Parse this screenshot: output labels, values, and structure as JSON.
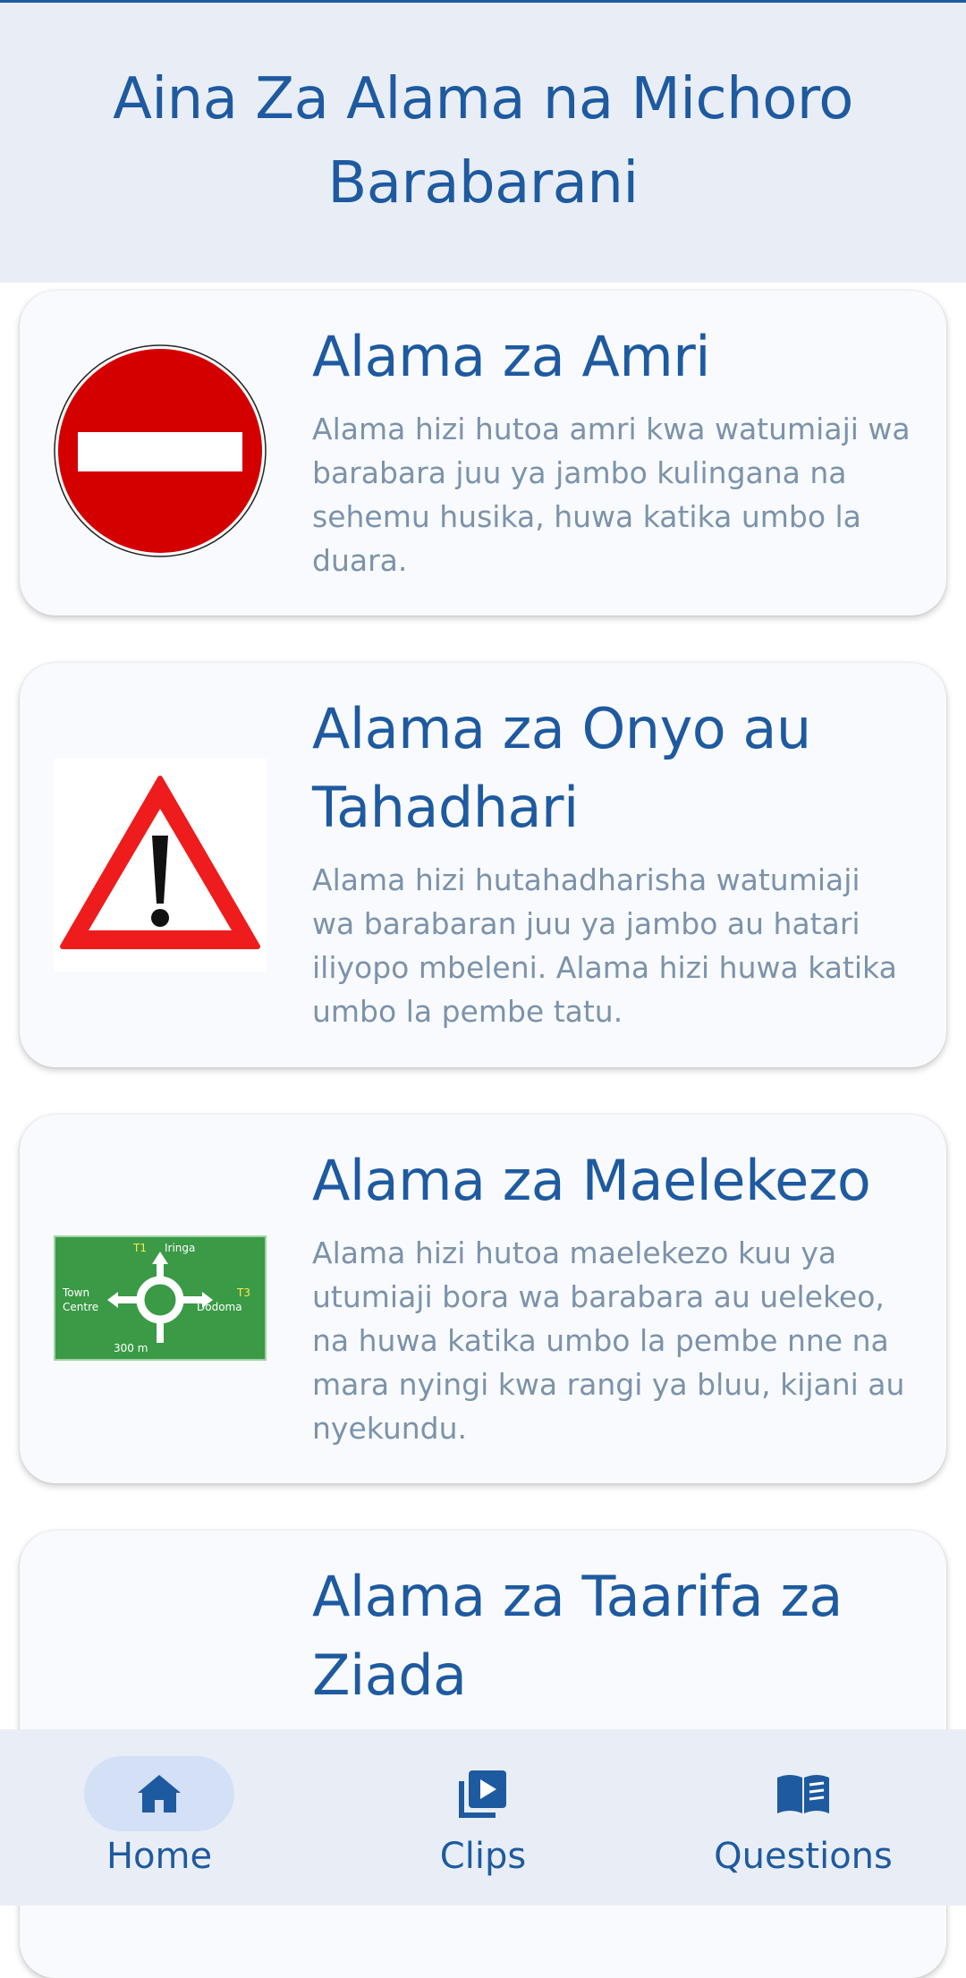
{
  "header": {
    "title": "Aina Za Alama na Michoro Barabarani"
  },
  "cards": [
    {
      "title": "Alama za Amri",
      "description": "Alama hizi hutoa amri kwa watumiaji wa barabara juu ya jambo kulingana na sehemu husika, huwa katika umbo la duara.",
      "image_icon": "no-entry-sign-icon"
    },
    {
      "title": "Alama za Onyo au Tahadhari",
      "description": "Alama hizi hutahadharisha watumiaji wa barabaran juu ya jambo au hatari iliyopo mbeleni. Alama hizi huwa katika umbo la pembe tatu.",
      "image_icon": "warning-triangle-icon"
    },
    {
      "title": "Alama za Maelekezo",
      "description": "Alama hizi hutoa maelekezo kuu ya utumiaji bora wa barabara au uelekeo, na huwa katika umbo la pembe nne na mara nyingi kwa rangi ya bluu, kijani au nyekundu.",
      "image_icon": "direction-sign-icon",
      "sign": {
        "top_code": "T1",
        "top_place": "Iringa",
        "left_place_1": "Town",
        "left_place_2": "Centre",
        "right_code": "T3",
        "right_place": "Dodoma",
        "distance": "300 m"
      }
    },
    {
      "title": "Alama za Taarifa za Ziada",
      "description": "",
      "image_icon": ""
    }
  ],
  "bottom_nav": {
    "items": [
      {
        "label": "Home",
        "icon": "home-icon",
        "active": true
      },
      {
        "label": "Clips",
        "icon": "clips-icon",
        "active": false
      },
      {
        "label": "Questions",
        "icon": "book-icon",
        "active": false
      }
    ]
  },
  "colors": {
    "primary": "#1e5aa0",
    "description_text": "#7b93ab",
    "header_bg": "#e9eef6",
    "card_bg": "#f9fafd",
    "active_pill": "#d3e0f5",
    "sign_red": "#d40000",
    "sign_green": "#3a9a46"
  }
}
